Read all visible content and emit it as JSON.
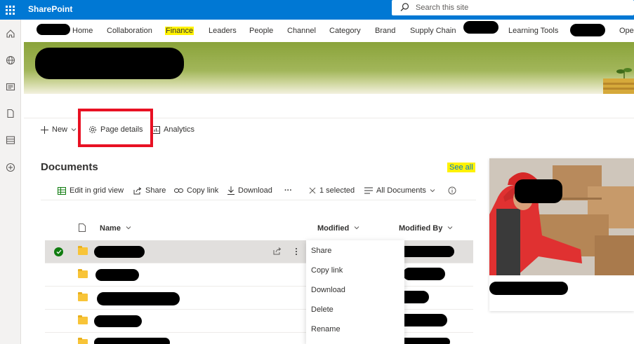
{
  "suitebar": {
    "brand": "SharePoint",
    "search_placeholder": "Search this site"
  },
  "topnav": {
    "items": [
      "Home",
      "Collaboration",
      "Finance",
      "Leaders",
      "People",
      "Channel",
      "Category",
      "Brand",
      "Supply Chain",
      "Learning Tools",
      "Ope"
    ],
    "highlighted": "Finance"
  },
  "commandbar": {
    "new_label": "New",
    "page_details_label": "Page details",
    "analytics_label": "Analytics"
  },
  "documents": {
    "title": "Documents",
    "see_all": "See all",
    "toolbar": {
      "edit_grid": "Edit in grid view",
      "share": "Share",
      "copy_link": "Copy link",
      "download": "Download",
      "more": "···",
      "selected": "1 selected",
      "view": "All Documents"
    },
    "columns": {
      "name": "Name",
      "modified": "Modified",
      "modified_by": "Modified By"
    }
  },
  "context_menu": [
    "Share",
    "Copy link",
    "Download",
    "Delete",
    "Rename"
  ],
  "colors": {
    "suitebar": "#0078d4",
    "highlight": "#fff200",
    "annotation": "#e81123",
    "selected_check": "#107c10",
    "folder": "#f8c438"
  }
}
